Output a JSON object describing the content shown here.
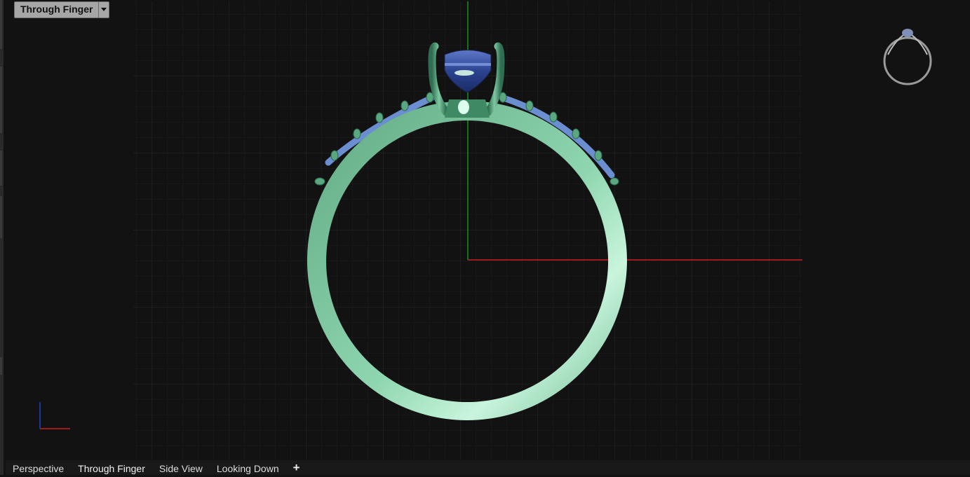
{
  "viewport": {
    "title": "Through Finger",
    "background": "#121212",
    "grid_color": "#262626",
    "x_axis_color": "#c81e1e",
    "y_axis_color": "#1e8c1e"
  },
  "model": {
    "metal_color": "#7fc4a0",
    "prong_color": "#4f9a74",
    "stone_color": "#3550a0",
    "accent_stone_color": "#6a8ed0"
  },
  "tabs": [
    {
      "label": "Perspective"
    },
    {
      "label": "Through Finger"
    },
    {
      "label": "Side View"
    },
    {
      "label": "Looking Down"
    }
  ],
  "add_tab_label": "+"
}
